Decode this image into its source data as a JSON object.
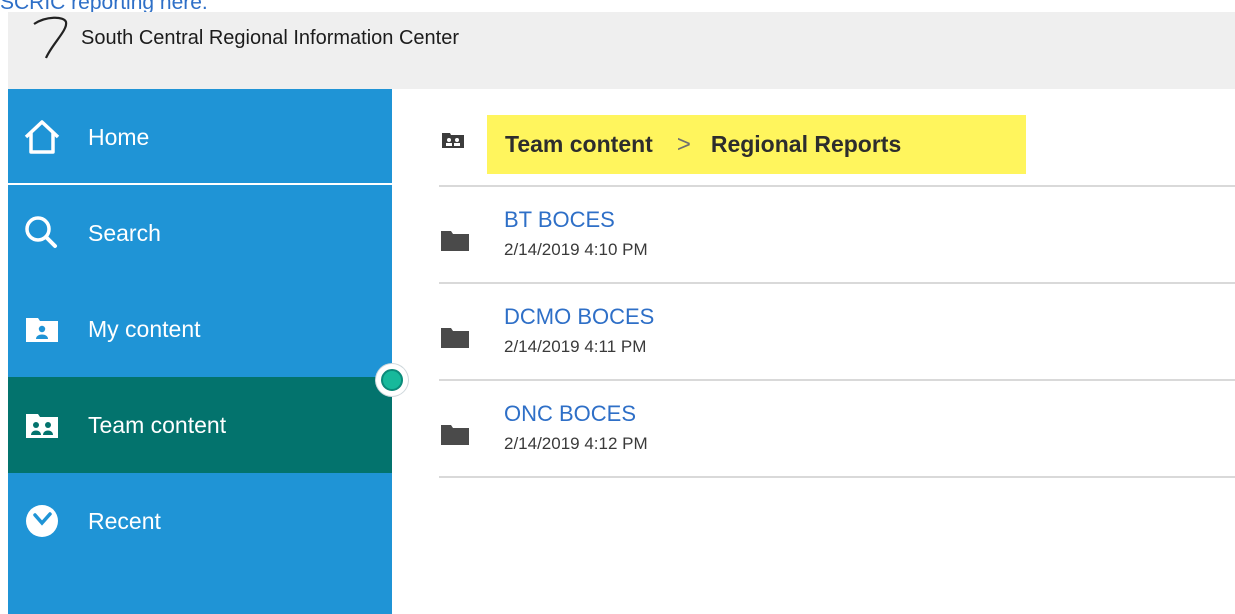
{
  "top_link": "SCRIC reporting here.",
  "header": {
    "title": "South Central Regional Information Center"
  },
  "sidebar": {
    "items": [
      {
        "label": "Home",
        "icon": "home-icon"
      },
      {
        "label": "Search",
        "icon": "search-icon"
      },
      {
        "label": "My content",
        "icon": "my-content-icon"
      },
      {
        "label": "Team content",
        "icon": "team-content-icon",
        "active": true
      },
      {
        "label": "Recent",
        "icon": "recent-icon"
      }
    ]
  },
  "breadcrumb": {
    "items": [
      "Team content",
      "Regional Reports"
    ],
    "separator": ">"
  },
  "content": {
    "rows": [
      {
        "name": "BT BOCES",
        "date": "2/14/2019 4:10 PM"
      },
      {
        "name": "DCMO BOCES",
        "date": "2/14/2019 4:11 PM"
      },
      {
        "name": "ONC BOCES",
        "date": "2/14/2019 4:12 PM"
      }
    ]
  },
  "colors": {
    "sidebar": "#1f94d6",
    "sidebar_active": "#03736d",
    "highlight": "#fff55d",
    "link": "#2e6fc7"
  }
}
